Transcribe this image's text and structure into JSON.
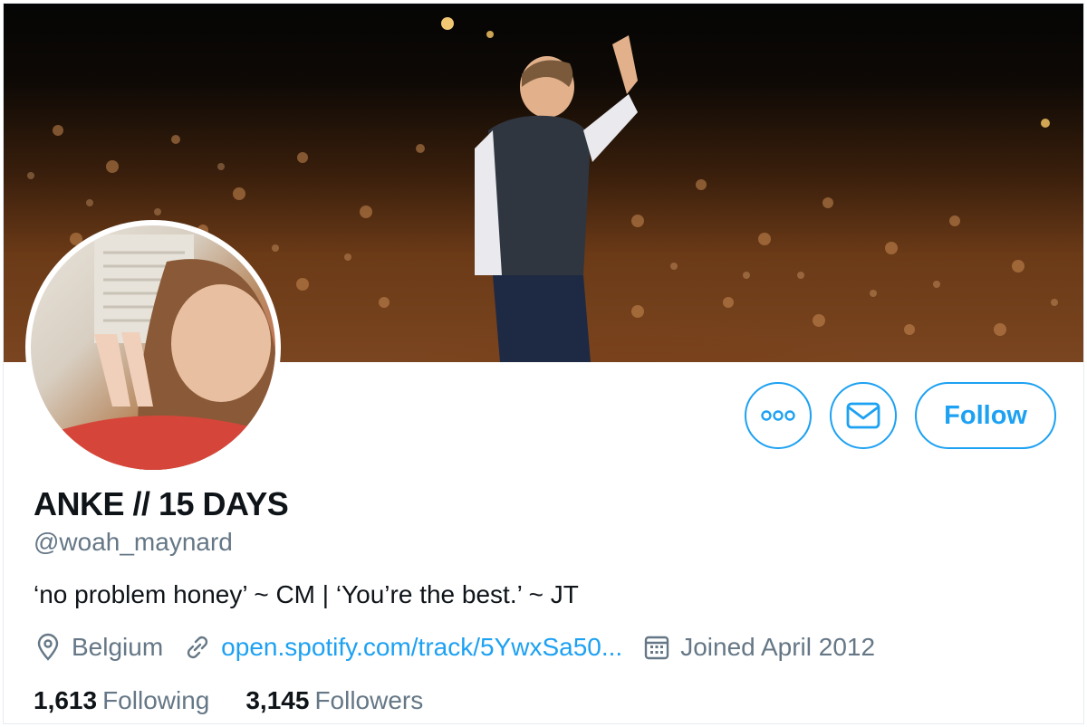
{
  "profile": {
    "display_name": "ANKE // 15 DAYS",
    "handle": "@woah_maynard",
    "bio": "‘no problem honey’ ~ CM | ‘You’re the best.’ ~ JT",
    "location": "Belgium",
    "website": "open.spotify.com/track/5YwxSa50...",
    "joined": "Joined April 2012"
  },
  "stats": {
    "following_count": "1,613",
    "following_label": "Following",
    "followers_count": "3,145",
    "followers_label": "Followers"
  },
  "actions": {
    "follow_label": "Follow",
    "more_icon": "more-icon",
    "message_icon": "envelope-icon"
  },
  "colors": {
    "accent": "#1da1f2",
    "secondary_text": "#657786",
    "primary_text": "#0f1419"
  }
}
